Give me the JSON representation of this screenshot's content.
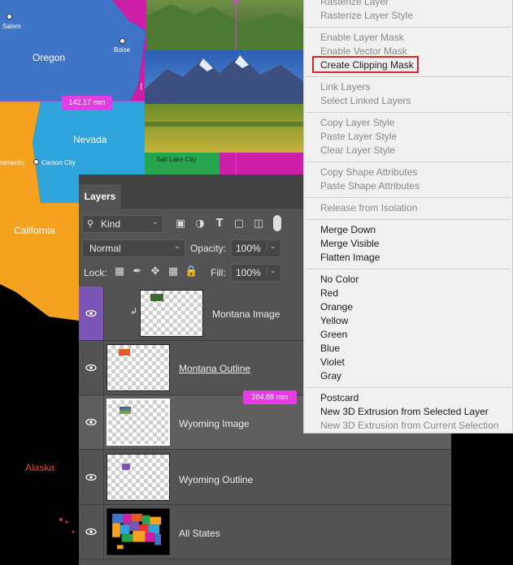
{
  "map": {
    "states": [
      "Oregon",
      "Nevada",
      "California",
      "Alaska"
    ],
    "cities": [
      "Salem",
      "Boise",
      "Carson City",
      "Salt Lake City",
      "ramento"
    ],
    "partial_label": "I",
    "measure_width": "142.17 mm",
    "measure_height": "384.88 mm"
  },
  "layers_panel": {
    "tab_label": "Layers",
    "filter_label": "Kind",
    "blend_mode": "Normal",
    "opacity_label": "Opacity:",
    "opacity_value": "100%",
    "lock_label": "Lock:",
    "fill_label": "Fill:",
    "fill_value": "100%",
    "layers": [
      {
        "name": "Montana Image"
      },
      {
        "name": "Montana Outline"
      },
      {
        "name": "Wyoming Image"
      },
      {
        "name": "Wyoming Outline"
      },
      {
        "name": "All States"
      }
    ]
  },
  "context_menu": {
    "group1": [
      "Rasterize Layer",
      "Rasterize Layer Style"
    ],
    "group2": [
      "Enable Layer Mask",
      "Enable Vector Mask",
      "Create Clipping Mask"
    ],
    "group3": [
      "Link Layers",
      "Select Linked Layers"
    ],
    "group4": [
      "Copy Layer Style",
      "Paste Layer Style",
      "Clear Layer Style"
    ],
    "group5": [
      "Copy Shape Attributes",
      "Paste Shape Attributes"
    ],
    "group6": [
      "Release from Isolation"
    ],
    "group7": [
      "Merge Down",
      "Merge Visible",
      "Flatten Image"
    ],
    "group8": [
      "No Color",
      "Red",
      "Orange",
      "Yellow",
      "Green",
      "Blue",
      "Violet",
      "Gray"
    ],
    "group9": [
      "Postcard",
      "New 3D Extrusion from Selected Layer",
      "New 3D Extrusion from Current Selection"
    ]
  },
  "colors": {
    "highlight_border": "#d7262b",
    "measure_bg": "#e63ce6",
    "selected_row": "#7a55b5"
  }
}
